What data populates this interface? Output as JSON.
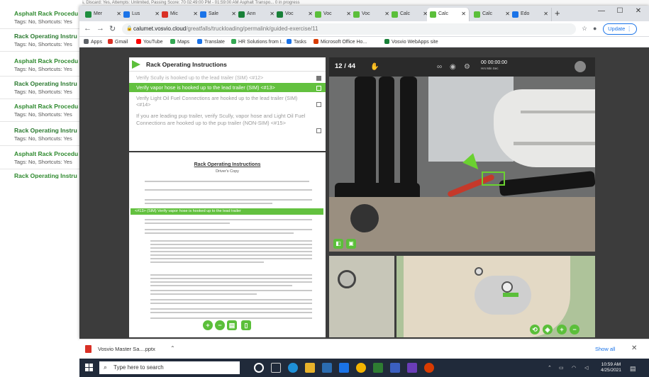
{
  "top_status_line": "Tags: No, Shortcuts: Yes, Retry: Yes, Discard: Yes, Attempts: Unlimited, Passing Score: 70     02:49:00 PM - 01:59:00 AM  Asphalt Transpo...     0 in progress",
  "background_list": [
    {
      "title": "Asphalt Rack Procedu",
      "sub": "Tags: No, Shortcuts: Yes"
    },
    {
      "title": "Rack Operating Instru",
      "sub": "Tags: No, Shortcuts: Yes"
    },
    {
      "title": "Asphalt Rack Procedu",
      "sub": "Tags: No, Shortcuts: Yes"
    },
    {
      "title": "Rack Operating Instru",
      "sub": "Tags: No, Shortcuts: Yes"
    },
    {
      "title": "Asphalt Rack Procedu",
      "sub": "Tags: No, Shortcuts: Yes"
    },
    {
      "title": "Rack Operating Instru",
      "sub": "Tags: No, Shortcuts: Yes"
    },
    {
      "title": "Asphalt Rack Procedu",
      "sub": "Tags: No, Shortcuts: Yes"
    },
    {
      "title": "Rack Operating Instru",
      "sub": ""
    }
  ],
  "browser": {
    "tabs": [
      {
        "label": "Mer",
        "color": "#1e8e3e"
      },
      {
        "label": "Lus",
        "color": "#1a73e8"
      },
      {
        "label": "Mic",
        "color": "#d93025"
      },
      {
        "label": "Sale",
        "color": "#1a73e8"
      },
      {
        "label": "Ann",
        "color": "#188038"
      },
      {
        "label": "Voc",
        "color": "#188038"
      },
      {
        "label": "Voc",
        "color": "#5bbf3a"
      },
      {
        "label": "Voc",
        "color": "#5bbf3a"
      },
      {
        "label": "Calc",
        "color": "#5bbf3a"
      },
      {
        "label": "Calc",
        "color": "#5bbf3a"
      },
      {
        "label": "Calc",
        "color": "#5bbf3a"
      },
      {
        "label": "Edo",
        "color": "#1a73e8"
      }
    ],
    "active_tab_index": 9,
    "url_host": "calumet.vosvio.cloud",
    "url_path": "/greatfalls/truckloading/permalink/guided-exercise/11",
    "update_label": "Update",
    "bookmarks": [
      {
        "label": "Apps",
        "color": "#5f6368"
      },
      {
        "label": "Gmail",
        "color": "#d93025"
      },
      {
        "label": "YouTube",
        "color": "#ff0000"
      },
      {
        "label": "Maps",
        "color": "#34a853"
      },
      {
        "label": "Translate",
        "color": "#1a73e8"
      },
      {
        "label": "HR Solutions from I...",
        "color": "#34a853"
      },
      {
        "label": "Tasks",
        "color": "#1a73e8"
      },
      {
        "label": "Microsoft Office Ho...",
        "color": "#d83b01"
      },
      {
        "label": "Vosvio WebApps site",
        "color": "#188038"
      }
    ]
  },
  "guide": {
    "title": "Rack Operating Instructions",
    "checklist": [
      {
        "text": "Verify Scully is hooked up to the lead trailer (SIM) <#12>",
        "state": "done"
      },
      {
        "text": "Verify vapor hose is hooked up to the lead trailer (SIM) <#13>",
        "state": "current"
      },
      {
        "text": "Verify Light Oil Fuel Connections are hooked up to the lead trailer (SIM) <#14>",
        "state": "todo"
      },
      {
        "text": "If you are leading pup trailer, verify Scully, vapor hose and Light Oil Fuel Connections are hooked up to the pup trailer (NON-SIM) <#15>",
        "state": "todo"
      }
    ],
    "doc_title": "Rack Operating Instructions",
    "doc_subtitle": "Driver's Copy",
    "doc_highlight": "<#13> (SIM) Verify vapor hose is hooked up to the lead trailer"
  },
  "viewer": {
    "step_count": "12 / 44",
    "timer_line1": "00 00:00:00",
    "timer_line2": "Hrs  Min  Sec"
  },
  "download": {
    "file_name": "Vosvio Master Sa....pptx",
    "show_all": "Show all"
  },
  "taskbar": {
    "search_placeholder": "Type here to search",
    "time": "10:59 AM",
    "date": "4/25/2021"
  },
  "colors": {
    "accent_green": "#5bbf3a",
    "tab_bar": "#dee1e6",
    "taskbar": "#202a3a",
    "viewport_dark": "#3c3c3c"
  }
}
